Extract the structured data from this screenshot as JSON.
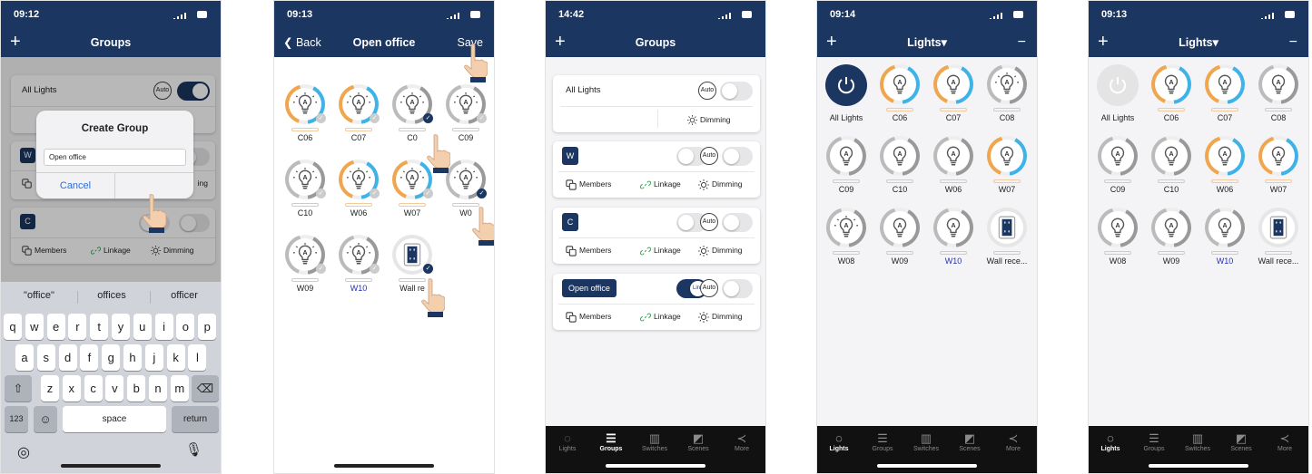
{
  "status": {
    "time1": "09:12",
    "time2": "09:13",
    "time3": "14:42",
    "time4": "09:14",
    "time5": "09:13"
  },
  "screen1": {
    "title": "Groups",
    "all_lights": "All Lights",
    "auto": "Auto",
    "chip_w": "W",
    "chip_c": "C",
    "members": "Members",
    "linkage": "Linkage",
    "dimming": "Dimming",
    "partial_ing": "ing",
    "dialog": {
      "title": "Create Group",
      "input_value": "Open office",
      "cancel": "Cancel"
    },
    "suggestions": [
      "\"office\"",
      "offices",
      "officer"
    ],
    "rows": [
      [
        "q",
        "w",
        "e",
        "r",
        "t",
        "y",
        "u",
        "i",
        "o",
        "p"
      ],
      [
        "a",
        "s",
        "d",
        "f",
        "g",
        "h",
        "j",
        "k",
        "l"
      ],
      [
        "z",
        "x",
        "c",
        "v",
        "b",
        "n",
        "m"
      ]
    ],
    "key_123": "123",
    "key_space": "space",
    "key_return": "return"
  },
  "screen2": {
    "back": "Back",
    "title": "Open office",
    "save": "Save",
    "devices": [
      {
        "label": "C06",
        "type": "warm"
      },
      {
        "label": "C07",
        "type": "warm"
      },
      {
        "label": "C08",
        "type": "gray",
        "partial": "C0"
      },
      {
        "label": "C09",
        "type": "gray"
      },
      {
        "label": "C10",
        "type": "gray"
      },
      {
        "label": "W06",
        "type": "warm"
      },
      {
        "label": "W07",
        "type": "warm"
      },
      {
        "label": "W08",
        "type": "gray",
        "partial": "W0"
      },
      {
        "label": "W09",
        "type": "gray"
      },
      {
        "label": "W10",
        "type": "gray"
      },
      {
        "label": "Wall receptacle",
        "type": "socket",
        "partial": "Wall re"
      }
    ]
  },
  "screen3": {
    "title": "Groups",
    "all_lights": "All Lights",
    "auto": "Auto",
    "link": "Link",
    "dimming": "Dimming",
    "members": "Members",
    "linkage": "Linkage",
    "groups": [
      {
        "chip": "W"
      },
      {
        "chip": "C"
      },
      {
        "chip": "Open office"
      }
    ]
  },
  "screen4": {
    "title": "Lights▾",
    "minus": "−"
  },
  "screen5": {
    "title": "Lights▾",
    "minus": "−"
  },
  "lights_grid": [
    "All Lights",
    "C06",
    "C07",
    "C08",
    "C09",
    "C10",
    "W06",
    "W07",
    "W08",
    "W09",
    "W10",
    "Wall rece..."
  ],
  "tabs": [
    "Lights",
    "Groups",
    "Switches",
    "Scenes",
    "More"
  ],
  "colors": {
    "navy": "#1b3660",
    "warm": "#f0a64e",
    "cool": "#3fb2e8",
    "gray": "#9b9b9b",
    "link_blue": "#2330b4"
  }
}
